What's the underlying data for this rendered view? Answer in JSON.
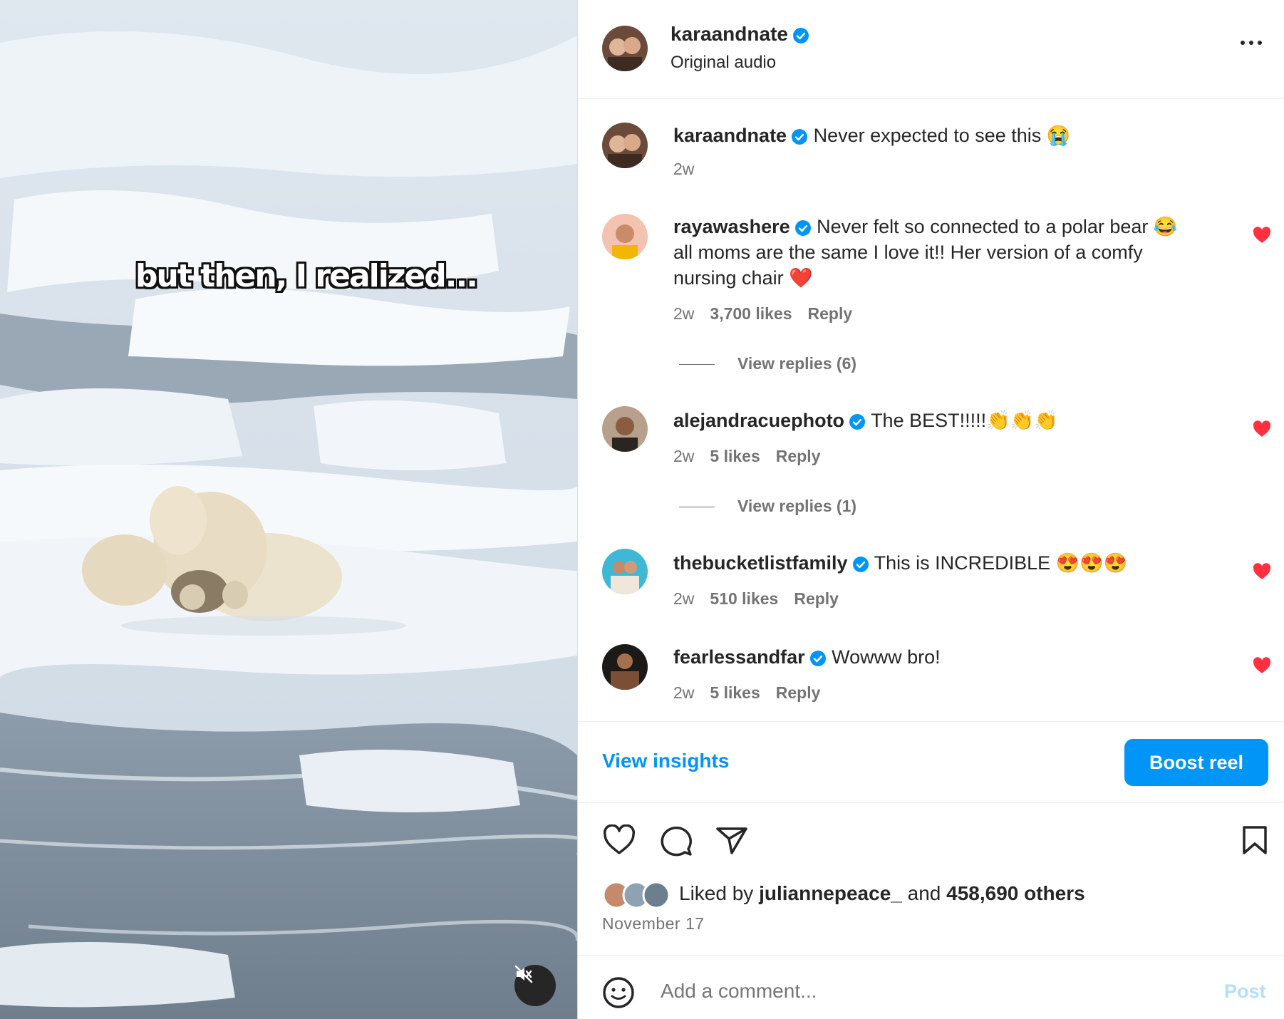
{
  "video": {
    "caption": "but then, I realized...",
    "mute_icon": "speaker-muted-icon"
  },
  "header": {
    "username": "karaandnate",
    "subtitle": "Original audio"
  },
  "caption_comment": {
    "username": "karaandnate",
    "text": "Never expected to see this 😭",
    "time": "2w"
  },
  "comments": [
    {
      "username": "rayawashere",
      "text_lines": [
        "Never felt so connected to a polar bear 😂",
        "all moms are the same I love it!! Her version of a comfy",
        "nursing chair ❤️"
      ],
      "time": "2w",
      "likes": "3,700 likes",
      "reply": "Reply",
      "view_replies": "View replies (6)"
    },
    {
      "username": "alejandracuephoto",
      "text": "The BEST!!!!!👏👏👏",
      "time": "2w",
      "likes": "5 likes",
      "reply": "Reply",
      "view_replies": "View replies (1)"
    },
    {
      "username": "thebucketlistfamily",
      "text": "This is INCREDIBLE 😍😍😍",
      "time": "2w",
      "likes": "510 likes",
      "reply": "Reply"
    },
    {
      "username": "fearlessandfar",
      "text": "Wowww bro!",
      "time": "2w",
      "likes": "5 likes",
      "reply": "Reply"
    }
  ],
  "insights": {
    "view_insights": "View insights",
    "boost": "Boost reel"
  },
  "likes": {
    "prefix": "Liked by",
    "user": "juliannepeace_",
    "middle": "and",
    "others": "458,690 others"
  },
  "date": "November 17",
  "composer": {
    "placeholder": "Add a comment...",
    "post": "Post"
  },
  "colors": {
    "accent": "#0095f6",
    "heart": "#ff3040",
    "verified": "#0095f6"
  }
}
